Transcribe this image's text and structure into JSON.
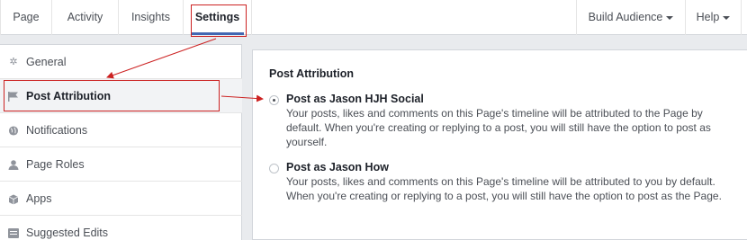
{
  "nav": {
    "tabs": [
      {
        "label": "Page"
      },
      {
        "label": "Activity"
      },
      {
        "label": "Insights"
      },
      {
        "label": "Settings"
      }
    ],
    "build_audience_label": "Build Audience",
    "help_label": "Help"
  },
  "sidebar": {
    "items": [
      {
        "label": "General",
        "icon": "gear-icon"
      },
      {
        "label": "Post Attribution",
        "icon": "flag-icon"
      },
      {
        "label": "Notifications",
        "icon": "globe-icon"
      },
      {
        "label": "Page Roles",
        "icon": "person-icon"
      },
      {
        "label": "Apps",
        "icon": "cube-icon"
      },
      {
        "label": "Suggested Edits",
        "icon": "list-icon"
      }
    ]
  },
  "main": {
    "title": "Post Attribution",
    "options": [
      {
        "title": "Post as Jason HJH Social",
        "description": "Your posts, likes and comments on this Page's timeline will be attributed to the Page by default. When you're creating or replying to a post, you will still have the option to post as yourself.",
        "checked": true
      },
      {
        "title": "Post as Jason How",
        "description": "Your posts, likes and comments on this Page's timeline will be attributed to you by default. When you're creating or replying to a post, you will still have the option to post as the Page.",
        "checked": false
      }
    ]
  },
  "colors": {
    "annotation": "#cc2222",
    "accent": "#4267b2"
  }
}
